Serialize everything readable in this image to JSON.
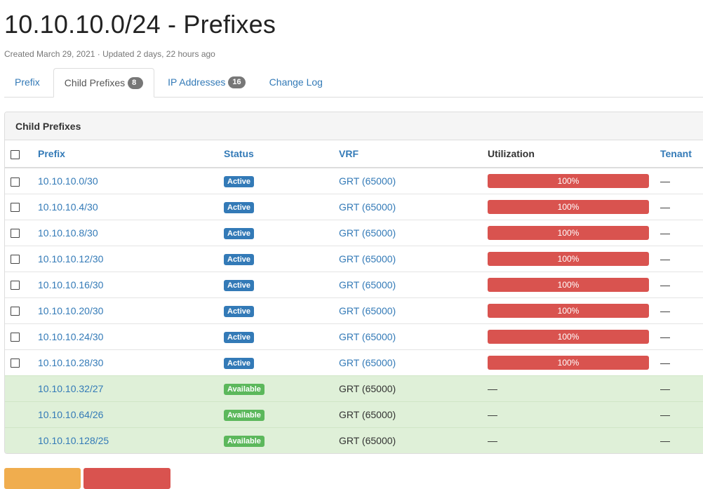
{
  "header": {
    "title": "10.10.10.0/24 - Prefixes",
    "meta": "Created March 29, 2021 · Updated 2 days, 22 hours ago"
  },
  "tabs": [
    {
      "label": "Prefix"
    },
    {
      "label": "Child Prefixes",
      "count": "8"
    },
    {
      "label": "IP Addresses",
      "count": "16"
    },
    {
      "label": "Change Log"
    }
  ],
  "panel": {
    "title": "Child Prefixes",
    "columns": [
      "Prefix",
      "Status",
      "VRF",
      "Utilization",
      "Tenant"
    ],
    "rows": [
      {
        "prefix": "10.10.10.0/30",
        "status": "Active",
        "vrf": "GRT (65000)",
        "utilization": "100%",
        "tenant": "—"
      },
      {
        "prefix": "10.10.10.4/30",
        "status": "Active",
        "vrf": "GRT (65000)",
        "utilization": "100%",
        "tenant": "—"
      },
      {
        "prefix": "10.10.10.8/30",
        "status": "Active",
        "vrf": "GRT (65000)",
        "utilization": "100%",
        "tenant": "—"
      },
      {
        "prefix": "10.10.10.12/30",
        "status": "Active",
        "vrf": "GRT (65000)",
        "utilization": "100%",
        "tenant": "—"
      },
      {
        "prefix": "10.10.10.16/30",
        "status": "Active",
        "vrf": "GRT (65000)",
        "utilization": "100%",
        "tenant": "—"
      },
      {
        "prefix": "10.10.10.20/30",
        "status": "Active",
        "vrf": "GRT (65000)",
        "utilization": "100%",
        "tenant": "—"
      },
      {
        "prefix": "10.10.10.24/30",
        "status": "Active",
        "vrf": "GRT (65000)",
        "utilization": "100%",
        "tenant": "—"
      },
      {
        "prefix": "10.10.10.28/30",
        "status": "Active",
        "vrf": "GRT (65000)",
        "utilization": "100%",
        "tenant": "—"
      },
      {
        "prefix": "10.10.10.32/27",
        "status": "Available",
        "vrf": "GRT (65000)",
        "utilization": "—",
        "tenant": "—"
      },
      {
        "prefix": "10.10.10.64/26",
        "status": "Available",
        "vrf": "GRT (65000)",
        "utilization": "—",
        "tenant": "—"
      },
      {
        "prefix": "10.10.10.128/25",
        "status": "Available",
        "vrf": "GRT (65000)",
        "utilization": "—",
        "tenant": "—"
      }
    ]
  },
  "colors": {
    "link": "#337ab7",
    "active_label": "#337ab7",
    "available_label": "#5cb85c",
    "available_row": "#dff0d8",
    "utilization_bar": "#d9534f",
    "edit_button": "#f0ad4e",
    "delete_button": "#d9534f"
  }
}
